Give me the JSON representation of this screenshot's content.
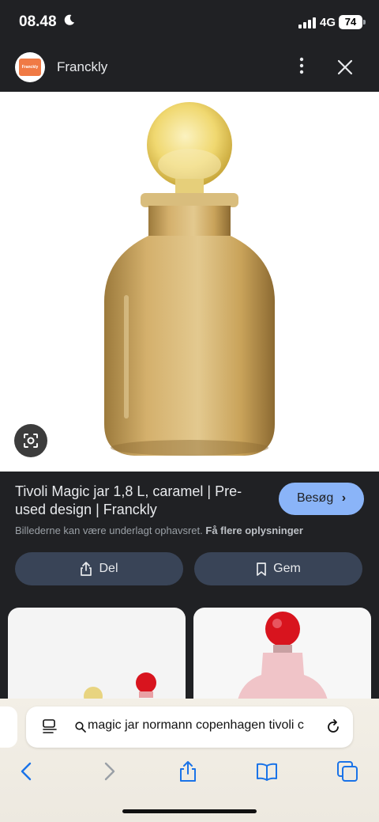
{
  "status_bar": {
    "time": "08.48",
    "network": "4G",
    "battery": "74",
    "icons": [
      "moon-icon",
      "signal-icon"
    ]
  },
  "source": {
    "site_name": "Franckly",
    "logo_text": "Franckly",
    "icons": [
      "more-vertical-icon",
      "close-icon"
    ]
  },
  "result": {
    "title": "Tivoli Magic jar 1,8 L, caramel | Pre-used design | Franckly",
    "visit_label": "Besøg",
    "copyright_text": "Billederne kan være underlagt ophavsret.",
    "more_info_link": "Få flere oplysninger",
    "share_label": "Del",
    "save_label": "Gem"
  },
  "browser": {
    "address_text": "magic jar normann copenhagen tivoli c",
    "icons": [
      "reader-icon",
      "search-icon",
      "reload-icon",
      "back-icon",
      "forward-icon",
      "share-icon",
      "bookmarks-icon",
      "tabs-icon"
    ]
  },
  "colors": {
    "background": "#202124",
    "accent": "#8ab4f8",
    "action_button": "#394457",
    "jar_amber": "#c9a35a",
    "stopper_yellow": "#f0d870",
    "red_stopper": "#d8141e"
  }
}
